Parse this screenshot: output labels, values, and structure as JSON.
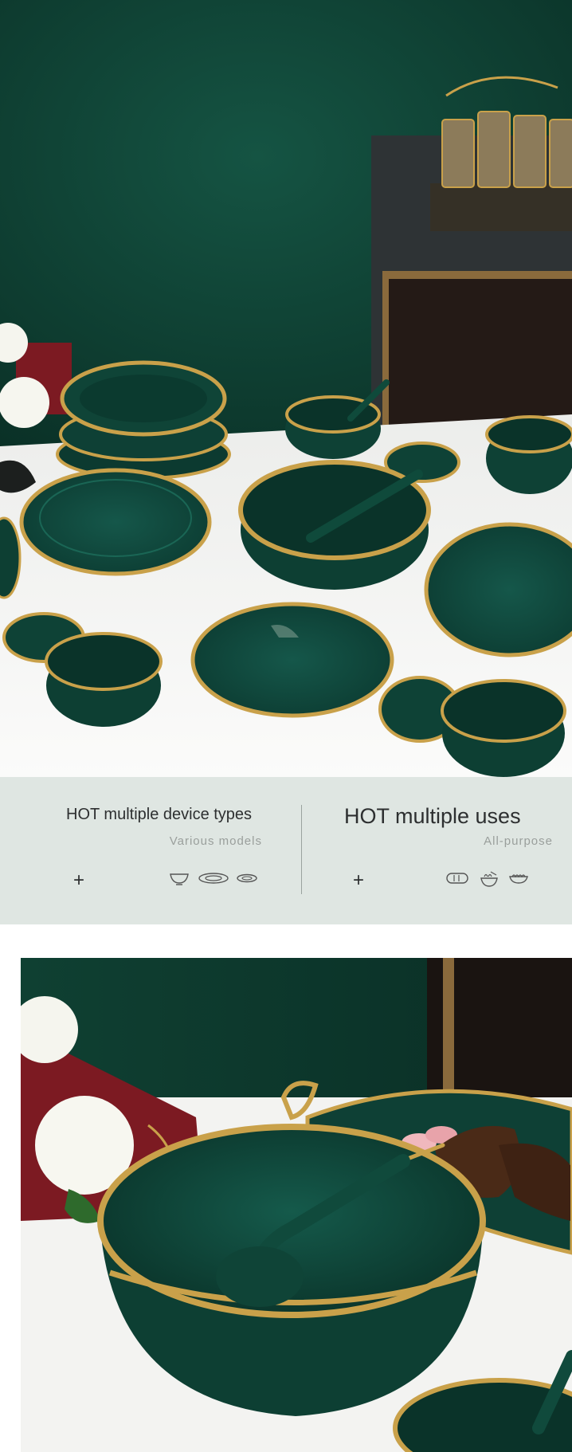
{
  "features": {
    "left": {
      "title": "HOT multiple device types",
      "subtitle": "Various models",
      "plus": "+",
      "icons": [
        "bowl-icon",
        "large-plate-icon",
        "small-plate-icon"
      ]
    },
    "right": {
      "title": "HOT multiple uses",
      "subtitle": "All-purpose",
      "plus": "+",
      "icons": [
        "bread-icon",
        "noodle-bowl-icon",
        "dish-icon"
      ]
    }
  },
  "colors": {
    "dark_green": "#0d3a2e",
    "gold": "#c9a14a",
    "strip_background": "#dfe6e2"
  }
}
